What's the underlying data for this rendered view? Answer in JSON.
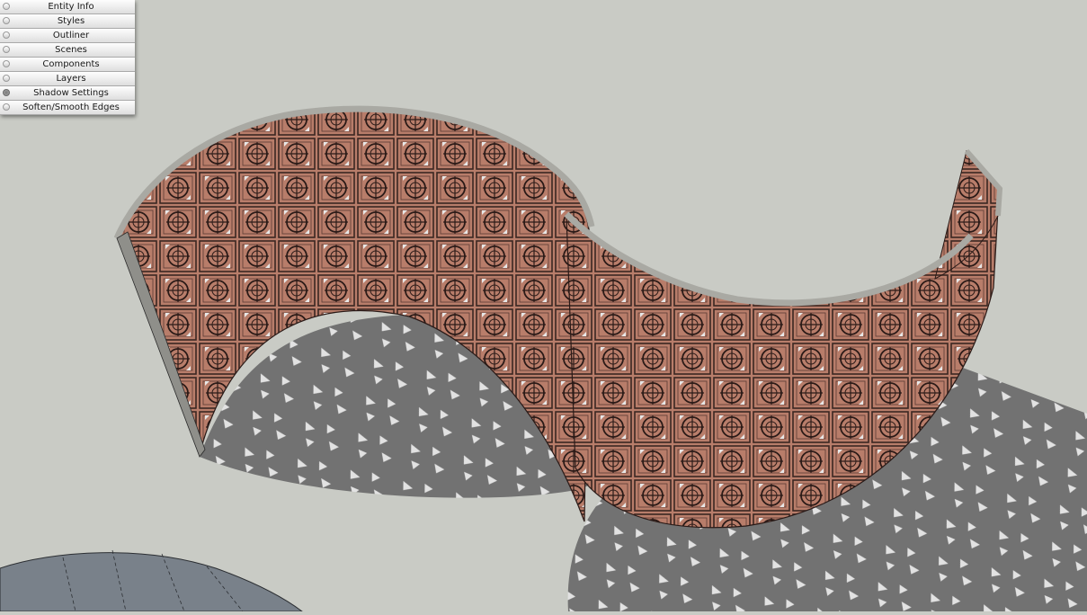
{
  "tray": {
    "items": [
      {
        "label": "Entity Info",
        "expanded": false
      },
      {
        "label": "Styles",
        "expanded": false
      },
      {
        "label": "Outliner",
        "expanded": false
      },
      {
        "label": "Scenes",
        "expanded": false
      },
      {
        "label": "Components",
        "expanded": false
      },
      {
        "label": "Layers",
        "expanded": false
      },
      {
        "label": "Shadow Settings",
        "expanded": true
      },
      {
        "label": "Soften/Smooth Edges",
        "expanded": false
      }
    ]
  },
  "scene": {
    "background_color": "#c9cbc5",
    "shadow_color": "#727272",
    "wall_color": "#b87d6a",
    "wall_edge_color": "#a9a9a3",
    "roof_color": "#79818a"
  }
}
